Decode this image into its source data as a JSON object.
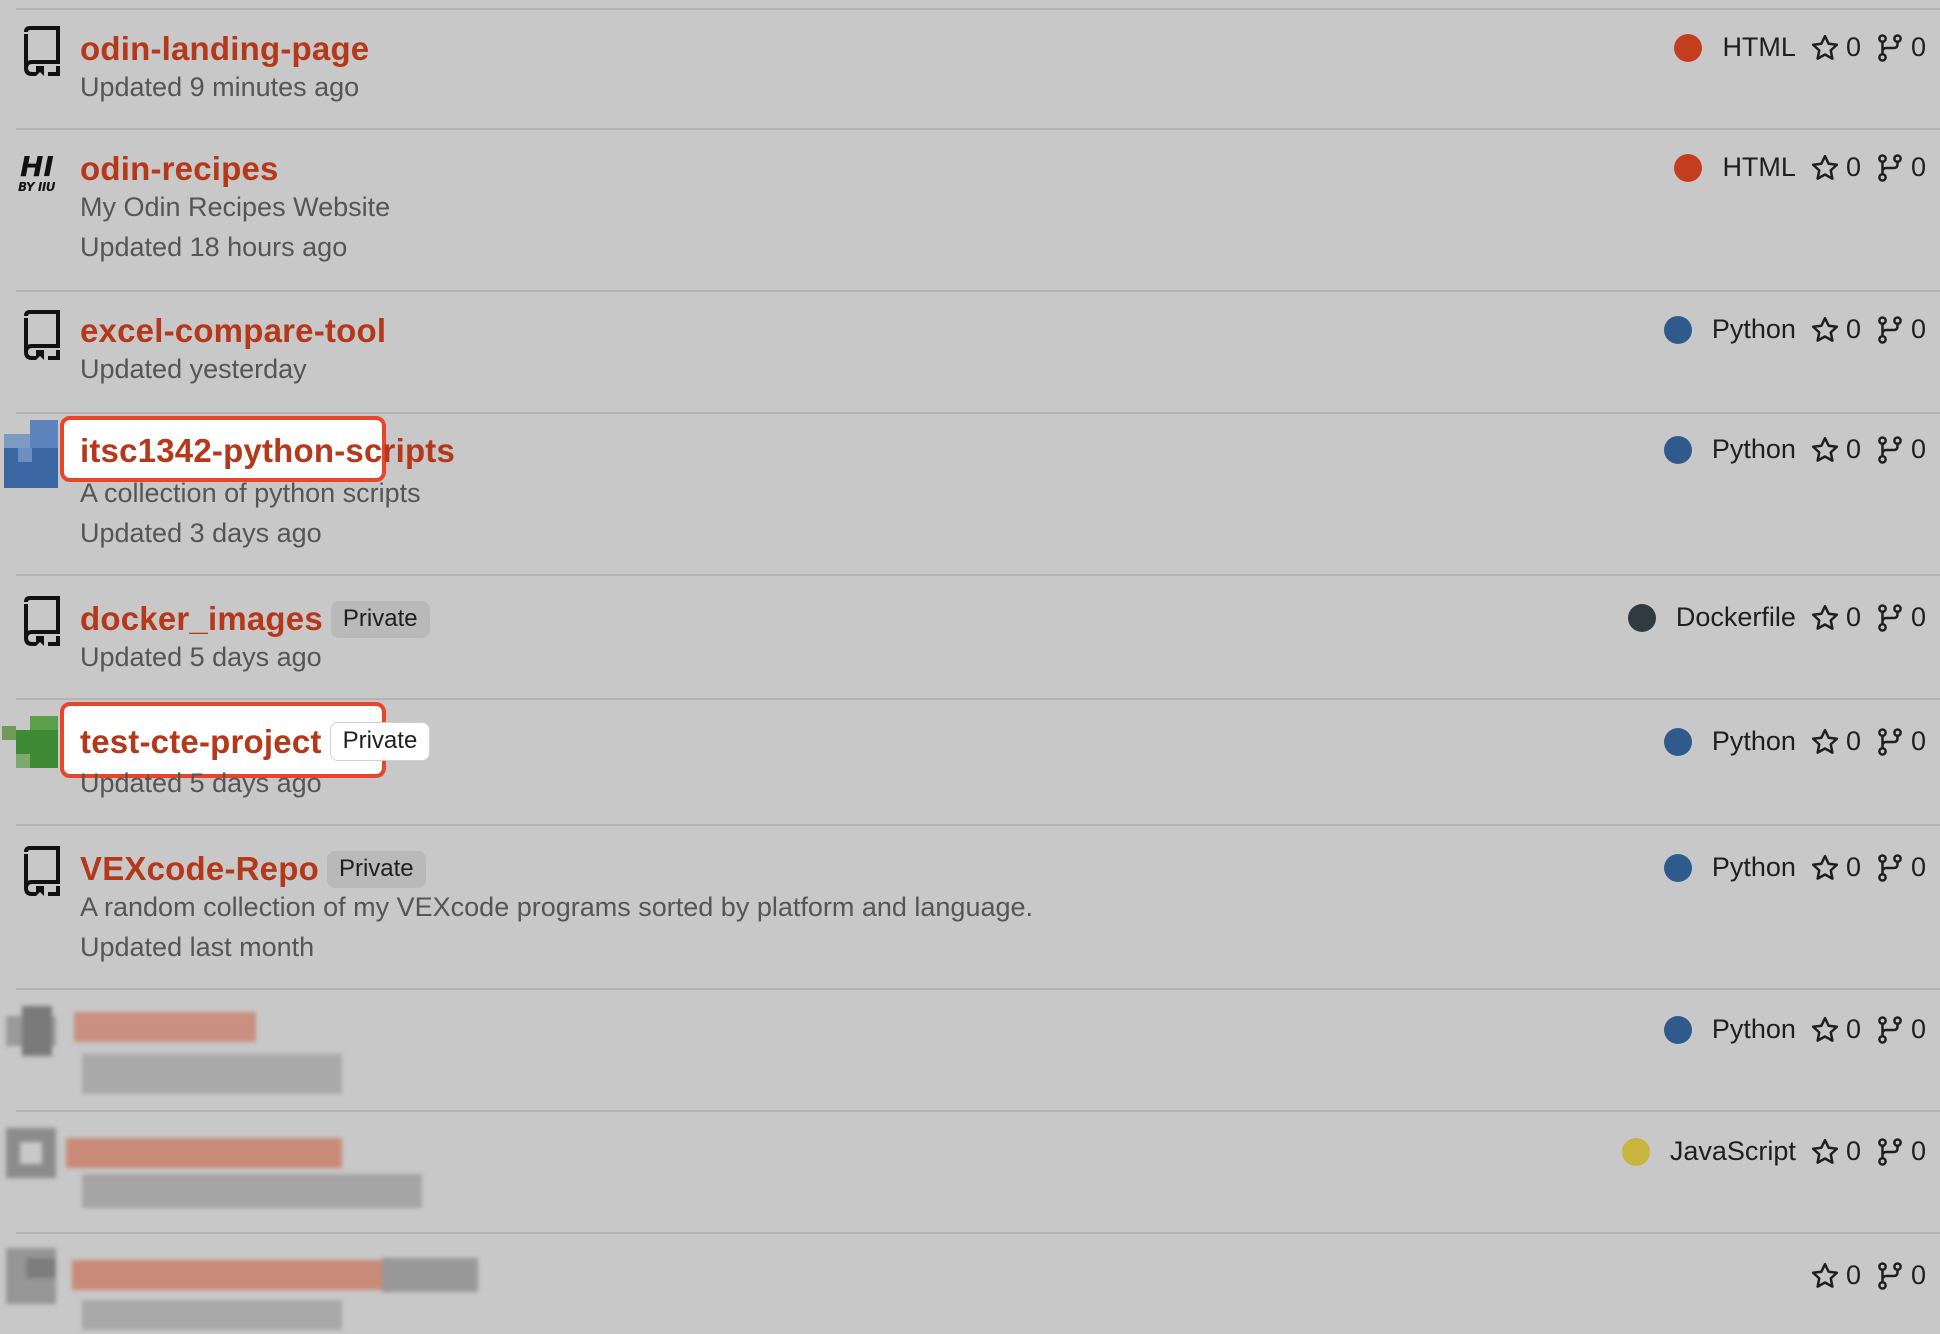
{
  "colors": {
    "background": "#c8c8c8",
    "repo_name": "#b5381b",
    "highlight": "#e8452a",
    "html": "#c33d1e",
    "python": "#2e5b8c",
    "dockerfile": "#2f3b40",
    "javascript": "#c8b53c"
  },
  "repos": [
    {
      "name": "odin-landing-page",
      "description": "",
      "updated": "Updated 9 minutes ago",
      "private": false,
      "language": "HTML",
      "language_color": "#c33d1e",
      "stars": "0",
      "forks": "0",
      "avatar": "repo-icon"
    },
    {
      "name": "odin-recipes",
      "description": "My Odin Recipes Website",
      "updated": "Updated 18 hours ago",
      "private": false,
      "language": "HTML",
      "language_color": "#c33d1e",
      "stars": "0",
      "forks": "0",
      "avatar": "hi-logo",
      "avatar_text": "HI",
      "avatar_subtext": "BY IIU"
    },
    {
      "name": "excel-compare-tool",
      "description": "",
      "updated": "Updated yesterday",
      "private": false,
      "language": "Python",
      "language_color": "#2e5b8c",
      "stars": "0",
      "forks": "0",
      "avatar": "repo-icon"
    },
    {
      "name": "itsc1342-python-scripts",
      "description": "A collection of python scripts",
      "updated": "Updated 3 days ago",
      "private": false,
      "highlighted": true,
      "language": "Python",
      "language_color": "#2e5b8c",
      "stars": "0",
      "forks": "0",
      "avatar": "pixel-avatar-blue"
    },
    {
      "name": "docker_images",
      "description": "",
      "updated": "Updated 5 days ago",
      "private": true,
      "private_label": "Private",
      "language": "Dockerfile",
      "language_color": "#2f3b40",
      "stars": "0",
      "forks": "0",
      "avatar": "repo-icon"
    },
    {
      "name": "test-cte-project",
      "description": "",
      "updated": "Updated 5 days ago",
      "private": true,
      "private_label": "Private",
      "highlighted": true,
      "language": "Python",
      "language_color": "#2e5b8c",
      "stars": "0",
      "forks": "0",
      "avatar": "pixel-avatar-green"
    },
    {
      "name": "VEXcode-Repo",
      "description": "A random collection of my VEXcode programs sorted by platform and language.",
      "updated": "Updated last month",
      "private": true,
      "private_label": "Private",
      "language": "Python",
      "language_color": "#2e5b8c",
      "stars": "0",
      "forks": "0",
      "avatar": "repo-icon"
    },
    {
      "name": "",
      "redacted": true,
      "language": "Python",
      "language_color": "#2e5b8c",
      "stars": "0",
      "forks": "0",
      "avatar": "pixel-avatar-gray"
    },
    {
      "name": "",
      "redacted": true,
      "language": "JavaScript",
      "language_color": "#c8b53c",
      "stars": "0",
      "forks": "0",
      "avatar": "pixel-avatar-gray"
    },
    {
      "name": "",
      "redacted": true,
      "language": "",
      "stars": "0",
      "forks": "0",
      "avatar": "pixel-avatar-gray"
    }
  ]
}
